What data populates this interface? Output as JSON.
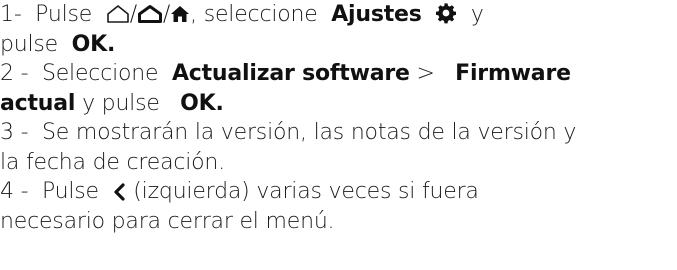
{
  "steps": [
    {
      "number": "1",
      "sep": "-",
      "verb": "Pulse",
      "home_sep_1": "/",
      "home_sep_2": "/",
      "after_icons": ", seleccione",
      "key_settings": "Ajustes",
      "conj": "y",
      "line2_verb": "pulse",
      "key_ok": "OK."
    },
    {
      "number": "2",
      "sep": "-",
      "verb": "Seleccione",
      "key_path_1": "Actualizar software",
      "arrow": ">",
      "key_path_2a": "Firmware",
      "key_path_2b": "actual",
      "tail": "y pulse",
      "key_ok": "OK."
    },
    {
      "number": "3",
      "sep": "-",
      "text_a": "Se mostrarán la versión, las notas de la versión y",
      "text_b": "la fecha de creación."
    },
    {
      "number": "4",
      "sep": "-",
      "verb": "Pulse",
      "after_icon": "(izquierda) varias veces si fuera",
      "text_b": "necesario para cerrar el menú."
    }
  ],
  "icons": {
    "home_outline": "home-outline-icon",
    "home_bold": "home-bold-icon",
    "home_filled": "home-filled-icon",
    "settings": "gear-icon",
    "back": "chevron-left-icon"
  }
}
